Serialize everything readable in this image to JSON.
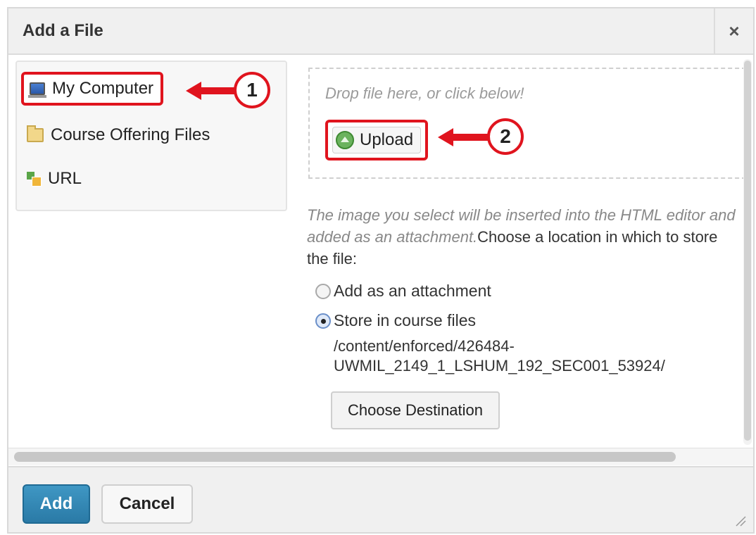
{
  "dialog": {
    "title": "Add a File",
    "close_glyph": "×"
  },
  "sources": [
    {
      "label": "My Computer",
      "icon": "computer-icon",
      "selected": true
    },
    {
      "label": "Course Offering Files",
      "icon": "folder-icon",
      "selected": false
    },
    {
      "label": "URL",
      "icon": "url-icon",
      "selected": false
    }
  ],
  "callouts": [
    "1",
    "2"
  ],
  "dropzone": {
    "hint": "Drop file here, or click below!",
    "upload_label": "Upload"
  },
  "info": {
    "italic_text": "The image you select will be inserted into the HTML editor and added as an attachment.",
    "plain_text": "Choose a location in which to store the file:"
  },
  "storage_options": [
    {
      "label": "Add as an attachment",
      "checked": false
    },
    {
      "label": "Store in course files",
      "checked": true
    }
  ],
  "destination": {
    "path_line1": "/content/enforced/426484-",
    "path_line2": "UWMIL_2149_1_LSHUM_192_SEC001_53924/",
    "choose_label": "Choose Destination"
  },
  "footer": {
    "add_label": "Add",
    "cancel_label": "Cancel"
  },
  "colors": {
    "callout_red": "#e0141e",
    "primary_button": "#2a7aa6"
  }
}
